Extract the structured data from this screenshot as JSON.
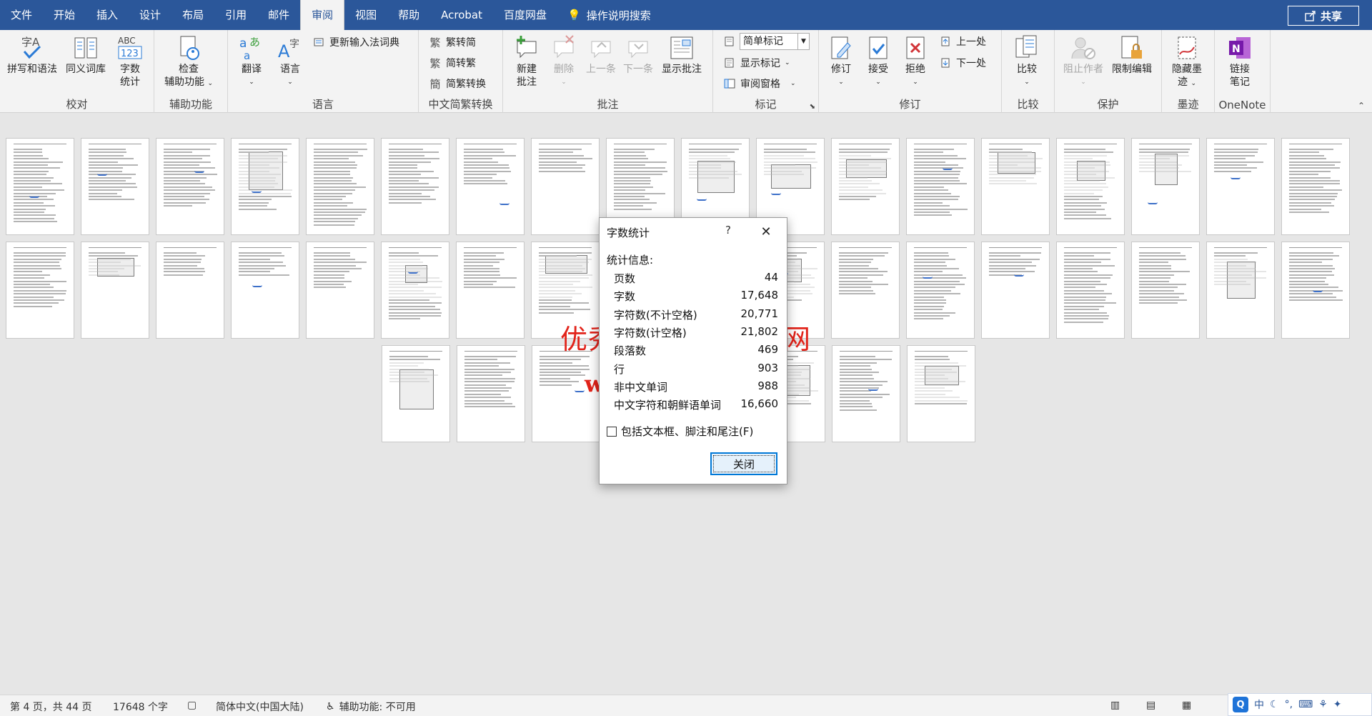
{
  "menu": {
    "tabs": [
      "文件",
      "开始",
      "插入",
      "设计",
      "布局",
      "引用",
      "邮件",
      "审阅",
      "视图",
      "帮助",
      "Acrobat",
      "百度网盘"
    ],
    "active_tab": "审阅",
    "tell_me": "操作说明搜索",
    "share": "共享"
  },
  "ribbon": {
    "proofing": {
      "label": "校对",
      "spelling": "拼写和语法",
      "thesaurus": "同义词库",
      "wordcount_l1": "字数",
      "wordcount_l2": "统计"
    },
    "accessibility": {
      "label": "辅助功能",
      "check_l1": "检查",
      "check_l2": "辅助功能"
    },
    "language": {
      "label": "语言",
      "translate": "翻译",
      "language": "语言",
      "update_ime": "更新输入法词典"
    },
    "chinese": {
      "label": "中文简繁转换",
      "to_trad": "繁转简",
      "to_simp": "简转繁",
      "convert": "简繁转换"
    },
    "comments": {
      "label": "批注",
      "new_l1": "新建",
      "new_l2": "批注",
      "delete": "删除",
      "prev": "上一条",
      "next": "下一条",
      "show": "显示批注"
    },
    "tracking": {
      "label": "标记",
      "markup_combo": "简单标记",
      "show_markup": "显示标记",
      "reviewing_pane": "审阅窗格"
    },
    "revisions": {
      "label": "修订",
      "track": "修订",
      "accept": "接受",
      "reject": "拒绝",
      "previous": "上一处",
      "next": "下一处"
    },
    "compare": {
      "label": "比较",
      "compare": "比较"
    },
    "protect": {
      "label": "保护",
      "block_authors": "阻止作者",
      "restrict": "限制编辑"
    },
    "ink": {
      "label": "墨迹",
      "hide_l1": "隐藏墨",
      "hide_l2": "迹"
    },
    "onenote": {
      "label": "OneNote",
      "link_l1": "链接",
      "link_l2": "笔记"
    }
  },
  "dialog": {
    "title": "字数统计",
    "help": "?",
    "section": "统计信息:",
    "stats": [
      {
        "label": "页数",
        "value": "44"
      },
      {
        "label": "字数",
        "value": "17,648"
      },
      {
        "label": "字符数(不计空格)",
        "value": "20,771"
      },
      {
        "label": "字符数(计空格)",
        "value": "21,802"
      },
      {
        "label": "段落数",
        "value": "469"
      },
      {
        "label": "行",
        "value": "903"
      },
      {
        "label": "非中文单词",
        "value": "988"
      },
      {
        "label": "中文字符和朝鲜语单词",
        "value": "16,660"
      }
    ],
    "checkbox": "包括文本框、脚注和尾注(F)",
    "close_button": "关闭"
  },
  "watermark": {
    "line1": "优秀毕业设计资源网",
    "line2": "www.keyicad.cn"
  },
  "statusbar": {
    "page": "第 4 页，共 44 页",
    "words": "17648 个字",
    "language": "简体中文(中国大陆)",
    "accessibility": "辅助功能: 不可用"
  },
  "tray": {
    "ime": "中"
  },
  "thumbnails": {
    "count": 44
  },
  "colors": {
    "accent": "#2b579a",
    "watermark": "#e2231a",
    "button_border": "#0078d7"
  }
}
